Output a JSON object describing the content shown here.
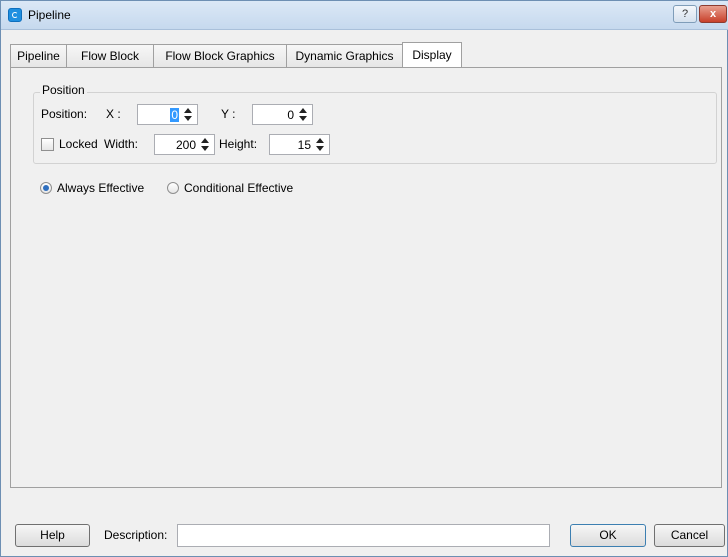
{
  "window": {
    "title": "Pipeline",
    "help_label": "?",
    "close_label": "x"
  },
  "tabs": [
    {
      "label": "Pipeline"
    },
    {
      "label": "Flow Block"
    },
    {
      "label": "Flow Block Graphics"
    },
    {
      "label": "Dynamic Graphics"
    },
    {
      "label": "Display"
    }
  ],
  "active_tab": "Display",
  "position_group": {
    "title": "Position",
    "position_label": "Position:",
    "x_label": "X :",
    "x_value": "0",
    "y_label": "Y :",
    "y_value": "0",
    "locked_label": "Locked",
    "locked_checked": false,
    "width_label": "Width:",
    "width_value": "200",
    "height_label": "Height:",
    "height_value": "15"
  },
  "effect": {
    "always_label": "Always Effective",
    "conditional_label": "Conditional Effective",
    "selected": "always"
  },
  "footer": {
    "help_label": "Help",
    "description_label": "Description:",
    "description_value": "",
    "ok_label": "OK",
    "cancel_label": "Cancel"
  }
}
